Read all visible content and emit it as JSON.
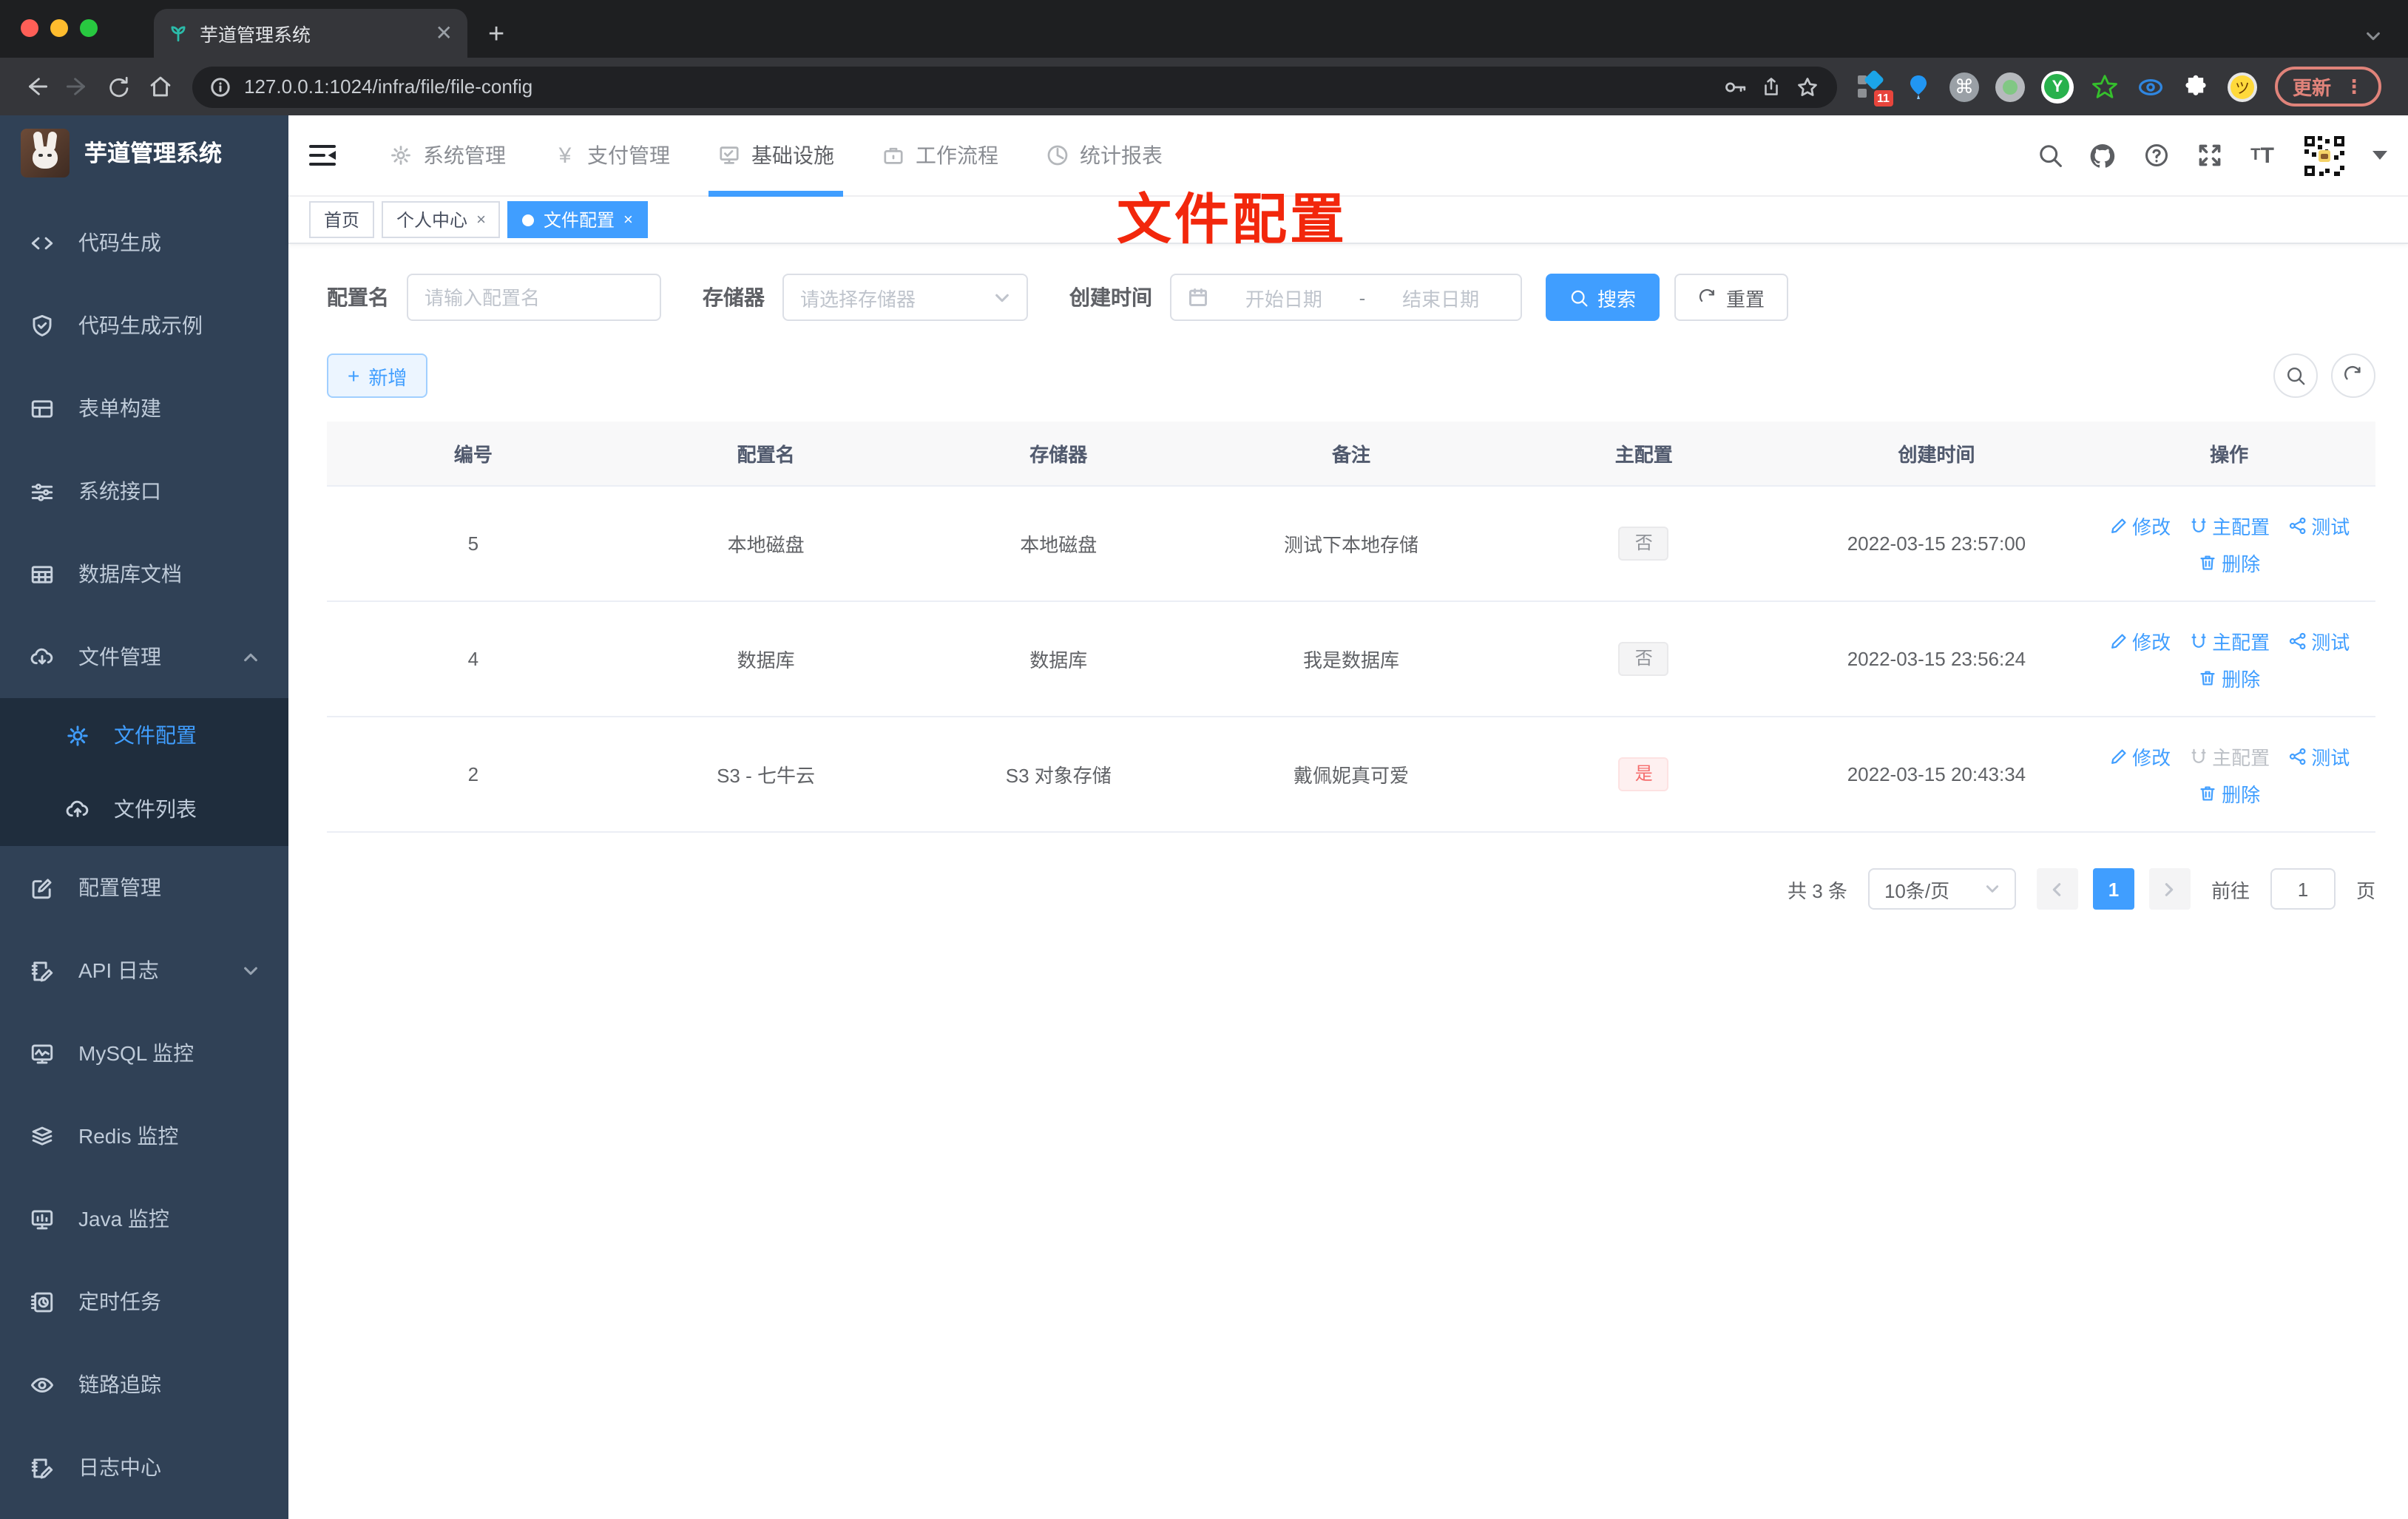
{
  "browser": {
    "tab_title": "芋道管理系统",
    "url": "127.0.0.1:1024/infra/file/file-config",
    "extension_badge": "11",
    "update_label": "更新"
  },
  "header": {
    "menus": [
      {
        "label": "系统管理"
      },
      {
        "label": "支付管理"
      },
      {
        "label": "基础设施"
      },
      {
        "label": "工作流程"
      },
      {
        "label": "统计报表"
      }
    ]
  },
  "sidebar": {
    "title": "芋道管理系统",
    "items": [
      {
        "label": "代码生成"
      },
      {
        "label": "代码生成示例"
      },
      {
        "label": "表单构建"
      },
      {
        "label": "系统接口"
      },
      {
        "label": "数据库文档"
      },
      {
        "label": "文件管理",
        "children": [
          {
            "label": "文件配置"
          },
          {
            "label": "文件列表"
          }
        ]
      },
      {
        "label": "配置管理"
      },
      {
        "label": "API 日志"
      },
      {
        "label": "MySQL 监控"
      },
      {
        "label": "Redis 监控"
      },
      {
        "label": "Java 监控"
      },
      {
        "label": "定时任务"
      },
      {
        "label": "链路追踪"
      },
      {
        "label": "日志中心"
      }
    ]
  },
  "tags": [
    {
      "label": "首页"
    },
    {
      "label": "个人中心"
    },
    {
      "label": "文件配置"
    }
  ],
  "annotation": {
    "text": "文件配置"
  },
  "filters": {
    "name_label": "配置名",
    "name_placeholder": "请输入配置名",
    "storage_label": "存储器",
    "storage_placeholder": "请选择存储器",
    "time_label": "创建时间",
    "start_placeholder": "开始日期",
    "range_separator": "-",
    "end_placeholder": "结束日期",
    "search_label": "搜索",
    "reset_label": "重置"
  },
  "toolbar": {
    "add_label": "新增"
  },
  "table": {
    "columns": [
      "编号",
      "配置名",
      "存储器",
      "备注",
      "主配置",
      "创建时间",
      "操作"
    ],
    "actions": {
      "edit": "修改",
      "master": "主配置",
      "test": "测试",
      "delete": "删除"
    },
    "rows": [
      {
        "id": "5",
        "name": "本地磁盘",
        "storage": "本地磁盘",
        "remark": "测试下本地存储",
        "master": "否",
        "time": "2022-03-15 23:57:00"
      },
      {
        "id": "4",
        "name": "数据库",
        "storage": "数据库",
        "remark": "我是数据库",
        "master": "否",
        "time": "2022-03-15 23:56:24"
      },
      {
        "id": "2",
        "name": "S3 - 七牛云",
        "storage": "S3 对象存储",
        "remark": "戴佩妮真可爱",
        "master": "是",
        "time": "2022-03-15 20:43:34"
      }
    ]
  },
  "pagination": {
    "total": "共 3 条",
    "page_size": "10条/页",
    "current": "1",
    "goto_label": "前往",
    "goto_value": "1",
    "page_unit": "页"
  }
}
